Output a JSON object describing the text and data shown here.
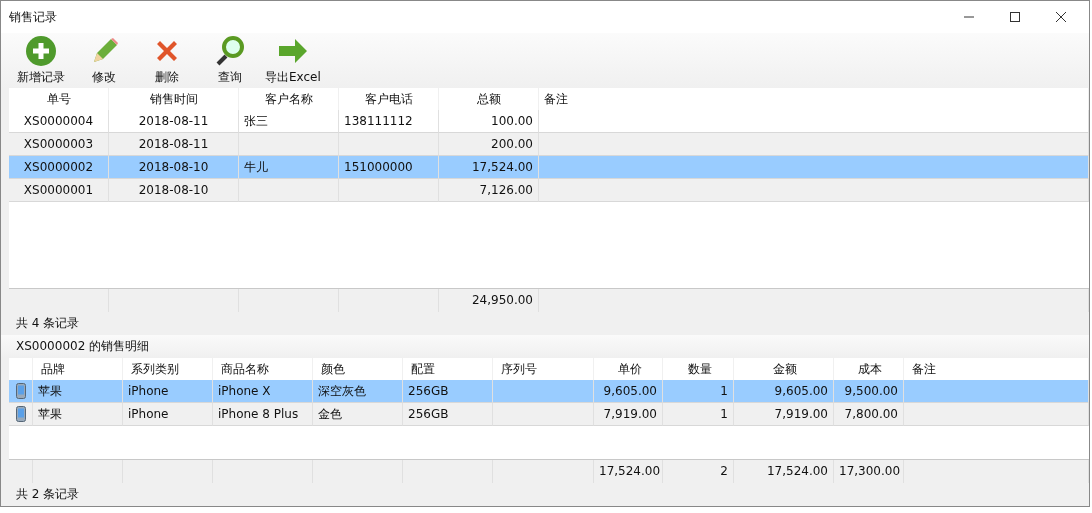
{
  "window": {
    "title": "销售记录"
  },
  "toolbar": [
    {
      "label": "新增记录"
    },
    {
      "label": "修改"
    },
    {
      "label": "删除"
    },
    {
      "label": "查询"
    },
    {
      "label": "导出Excel"
    }
  ],
  "sales_table": {
    "columns": [
      "单号",
      "销售时间",
      "客户名称",
      "客户电话",
      "总额",
      "备注"
    ],
    "rows": [
      {
        "selected": false,
        "order_no": "XS0000004",
        "sale_time": "2018-08-11",
        "customer_name": "张三",
        "customer_phone": "138111112",
        "total_amount": "100.00"
      },
      {
        "selected": false,
        "order_no": "XS0000003",
        "sale_time": "2018-08-11",
        "total_amount": "200.00"
      },
      {
        "selected": true,
        "order_no": "XS0000002",
        "sale_time": "2018-08-10",
        "customer_name": "牛儿",
        "customer_phone": "151000000",
        "total_amount": "17,524.00"
      },
      {
        "selected": false,
        "order_no": "XS0000001",
        "sale_time": "2018-08-10",
        "total_amount": "7,126.00"
      }
    ],
    "totals": {
      "total_amount": "24,950.00"
    },
    "record_count": "共 4 条记录"
  },
  "detail": {
    "title": "XS0000002 的销售明细",
    "columns": [
      "品牌",
      "系列类别",
      "商品名称",
      "颜色",
      "配置",
      "序列号",
      "单价",
      "数量",
      "金额",
      "成本",
      "备注"
    ],
    "rows": [
      {
        "selected": true,
        "brand": "苹果",
        "series": "iPhone",
        "product_name": "iPhone X",
        "color_name": "深空灰色",
        "configuration": "256GB",
        "unit_price": "9,605.00",
        "quantity": "1",
        "amount": "9,605.00",
        "cost": "9,500.00"
      },
      {
        "selected": false,
        "brand": "苹果",
        "series": "iPhone",
        "product_name": "iPhone 8 Plus",
        "color_name": "金色",
        "configuration": "256GB",
        "unit_price": "7,919.00",
        "quantity": "1",
        "amount": "7,919.00",
        "cost": "7,800.00"
      }
    ],
    "totals": {
      "unit_price": "17,524.00",
      "quantity": "2",
      "amount": "17,524.00",
      "cost": "17,300.00"
    },
    "record_count": "共 2 条记录"
  }
}
